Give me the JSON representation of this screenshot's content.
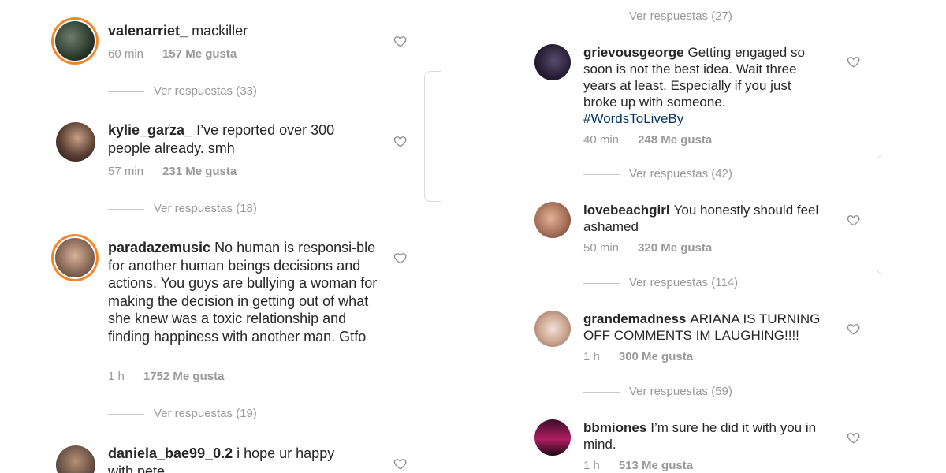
{
  "left": [
    {
      "username": "valenarriet_",
      "text": "mackiller",
      "time": "60 min",
      "likes": "157 Me gusta",
      "replies": "Ver respuestas (33)"
    },
    {
      "username": "kylie_garza_",
      "text": "I’ve reported over 300 people already. smh",
      "time": "57 min",
      "likes": "231 Me gusta",
      "replies": "Ver respuestas (18)"
    },
    {
      "username": "paradazemusic",
      "text": "No human is responsi-ble for another human beings decisions and actions. You guys are bullying a woman for making the decision in getting out of what she knew was a toxic relationship and finding happiness with another man. Gtfo",
      "time": "1 h",
      "likes": "1752 Me gusta",
      "replies": "Ver respuestas (19)"
    },
    {
      "username": "daniela_bae99_0.2",
      "text": "i hope ur happy with pete"
    }
  ],
  "right": [
    {
      "replies_top": "Ver respuestas (27)"
    },
    {
      "username": "grievousgeorge",
      "text": "Getting engaged so soon is not the best idea. Wait three years at least. Especially if you just broke up with someone.",
      "hashtag": "#WordsToLiveBy",
      "time": "40 min",
      "likes": "248 Me gusta",
      "replies": "Ver respuestas (42)"
    },
    {
      "username": "lovebeachgirl",
      "text": "You honestly should feel ashamed",
      "time": "50 min",
      "likes": "320 Me gusta",
      "replies": "Ver respuestas (114)"
    },
    {
      "username": "grandemadness",
      "text": "ARIANA IS TURNING OFF COMMENTS IM LAUGHING!!!!",
      "time": "1 h",
      "likes": "300 Me gusta",
      "replies": "Ver respuestas (59)"
    },
    {
      "username": "bbmiones",
      "text": "I’m sure he did it with you in mind.",
      "time": "1 h",
      "likes": "513 Me gusta"
    }
  ],
  "icons": {
    "like": "heart-outline-icon"
  },
  "colors": {
    "text": "#262626",
    "muted": "#999999",
    "hashtag": "#003569",
    "story_ring": "#e1306c"
  }
}
